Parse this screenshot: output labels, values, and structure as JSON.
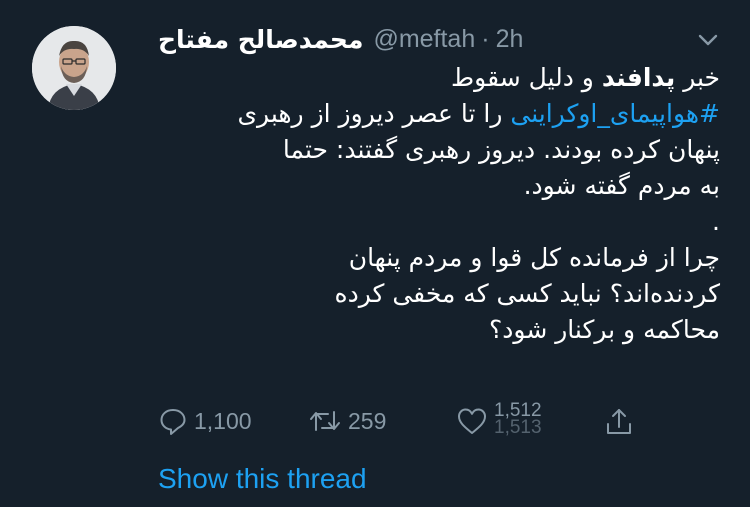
{
  "author": {
    "display_name": "محمدصالح مفتاح",
    "handle": "@meftah",
    "separator": "·",
    "time": "2h"
  },
  "tweet": {
    "line1_prefix": "خبر ",
    "line1_bold": "پدافند",
    "line1_suffix": " و دلیل سقوط",
    "line2_hashtag": "#هواپیمای_اوکراینی",
    "line2_rest": " را تا عصر دیروز از رهبری",
    "line3": "پنهان کرده بودند. دیروز رهبری گفتند: حتما",
    "line4": "به مردم گفته شود.",
    "line5": ".",
    "line6": "چرا از فرمانده کل قوا و مردم پنهان",
    "line7": "کردنده‌اند؟ نباید کسی که مخفی کرده",
    "line8": "محاکمه و برکنار شود؟"
  },
  "actions": {
    "reply_count": "1,100",
    "retweet_count": "259",
    "like_count": "1,512",
    "like_count_next": "1,513"
  },
  "show_thread_label": "Show this thread",
  "icons": {
    "avatar": "profile-photo",
    "menu": "chevron-down-icon",
    "reply": "reply-icon",
    "retweet": "retweet-icon",
    "like": "heart-icon",
    "share": "share-icon"
  },
  "colors": {
    "background": "#15202b",
    "text": "#ffffff",
    "muted": "#8899a6",
    "accent": "#1da1f2"
  }
}
